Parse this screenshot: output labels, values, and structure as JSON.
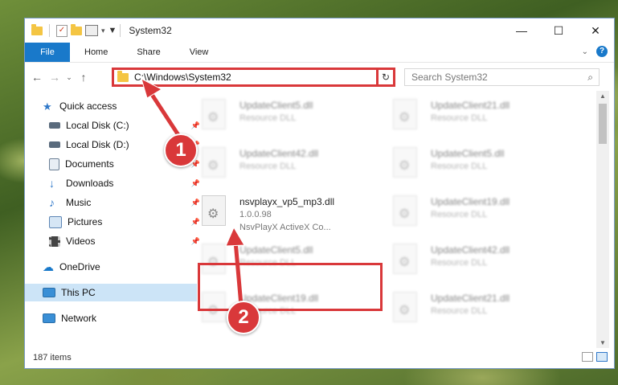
{
  "window": {
    "title": "System32",
    "controls": {
      "minimize": "—",
      "maximize": "☐",
      "close": "✕"
    }
  },
  "ribbon": {
    "file_tab": "File",
    "tabs": [
      "Home",
      "Share",
      "View"
    ]
  },
  "nav": {
    "address": "C:\\Windows\\System32",
    "search_placeholder": "Search System32"
  },
  "sidebar": {
    "items": [
      {
        "label": "Quick access",
        "icon": "star-icon",
        "color": "#2f78c9"
      },
      {
        "label": "Local Disk (C:)",
        "icon": "drive-icon",
        "color": "#5a6b7d"
      },
      {
        "label": "Local Disk (D:)",
        "icon": "drive-icon",
        "color": "#5a6b7d"
      },
      {
        "label": "Documents",
        "icon": "documents-icon",
        "color": "#6b7f95"
      },
      {
        "label": "Downloads",
        "icon": "downloads-icon",
        "color": "#2f78c9"
      },
      {
        "label": "Music",
        "icon": "music-icon",
        "color": "#2f78c9"
      },
      {
        "label": "Pictures",
        "icon": "pictures-icon",
        "color": "#5d86b5"
      },
      {
        "label": "Videos",
        "icon": "videos-icon",
        "color": "#444444"
      },
      {
        "label": "OneDrive",
        "icon": "cloud-icon",
        "color": "#1979ca"
      },
      {
        "label": "This PC",
        "icon": "computer-icon",
        "color": "#3a8fd6"
      },
      {
        "label": "Network",
        "icon": "network-icon",
        "color": "#3a8fd6"
      }
    ]
  },
  "files": {
    "left": [
      {
        "name": "UpdateClient5.dll",
        "desc": "Resource DLL"
      },
      {
        "name": "UpdateClient42.dll",
        "desc": "Resource DLL"
      },
      {
        "name": "UpdateClient5.dll",
        "desc": "Resource DLL"
      },
      {
        "name": "UpdateClient19.dll",
        "desc": "Resource DLL"
      }
    ],
    "highlighted": {
      "name": "nsvplayx_vp5_mp3.dll",
      "version": "1.0.0.98",
      "desc": "NsvPlayX ActiveX Co..."
    },
    "right": [
      {
        "name": "UpdateClient21.dll",
        "desc": "Resource DLL"
      },
      {
        "name": "UpdateClient5.dll",
        "desc": "Resource DLL"
      },
      {
        "name": "UpdateClient19.dll",
        "desc": "Resource DLL"
      },
      {
        "name": "UpdateClient42.dll",
        "desc": "Resource DLL"
      },
      {
        "name": "UpdateClient21.dll",
        "desc": "Resource DLL"
      }
    ]
  },
  "status": {
    "items": "187 items"
  },
  "annotations": {
    "step1": "1",
    "step2": "2",
    "color": "#d9383a"
  }
}
